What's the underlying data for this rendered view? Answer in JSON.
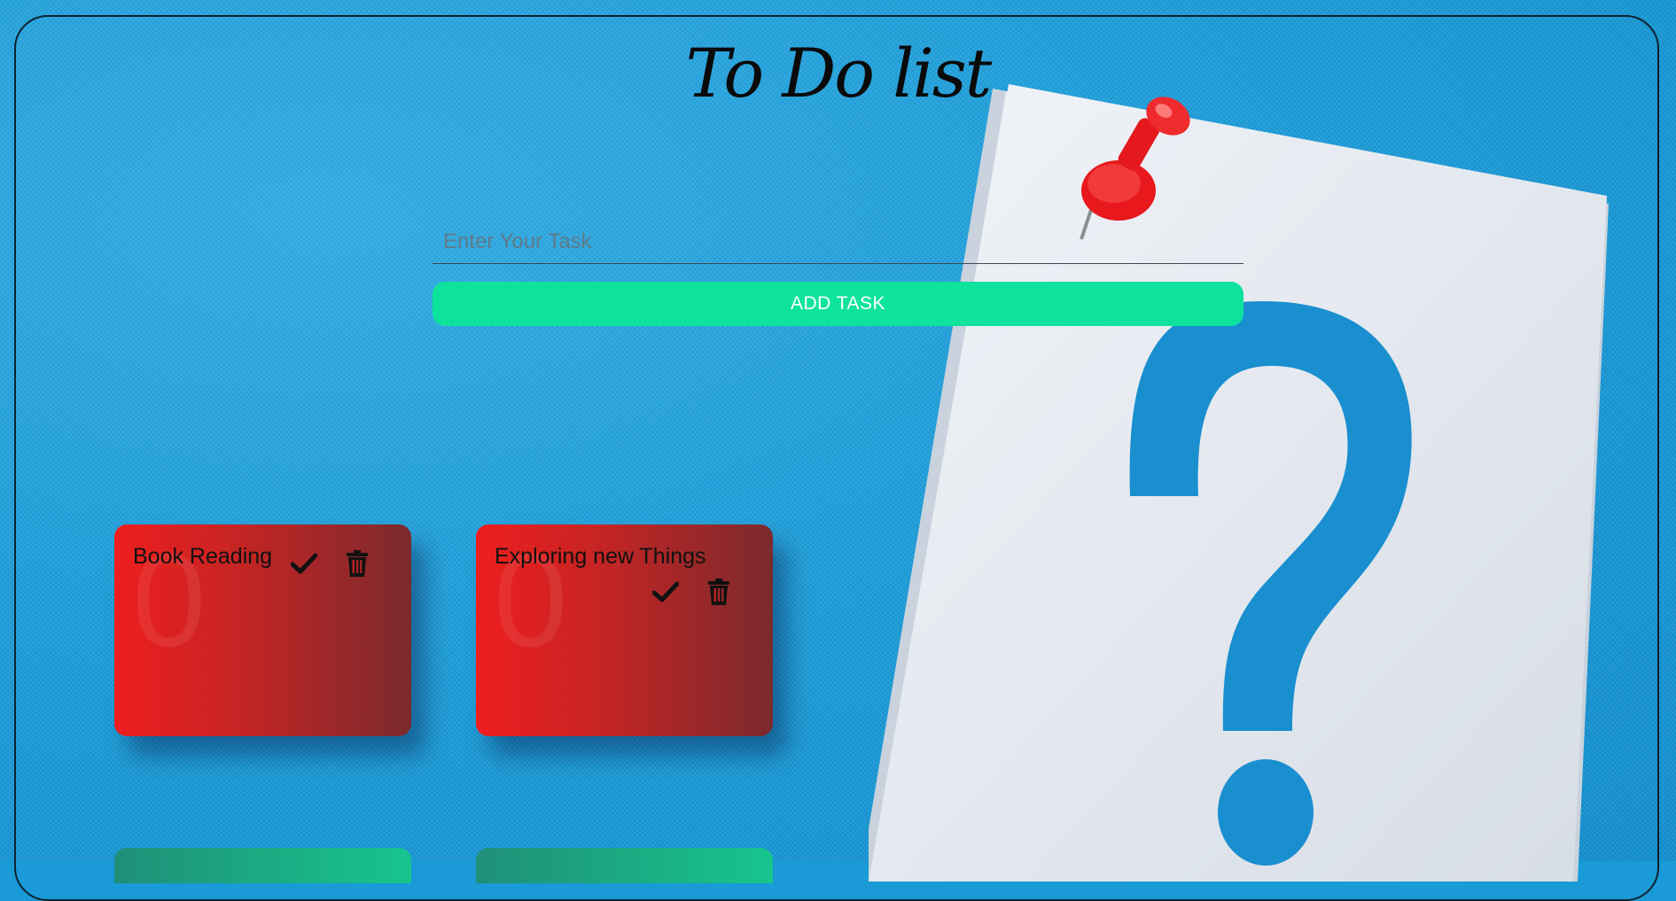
{
  "app": {
    "title": "To Do list"
  },
  "input": {
    "placeholder": "Enter Your Task",
    "value": ""
  },
  "add_button": {
    "label": "ADD TASK",
    "color": "#0ee39e"
  },
  "tasks": [
    {
      "text": "Book Reading",
      "number": "0",
      "status": "pending"
    },
    {
      "text": "Exploring new Things",
      "number": "0",
      "status": "pending"
    }
  ],
  "icons": {
    "complete": "check-icon",
    "delete": "trash-icon"
  },
  "colors": {
    "background": "#1a9ad6",
    "card_start": "#ee1e1e",
    "card_end": "#7a2a2d",
    "card_completed": "#17c58d"
  }
}
